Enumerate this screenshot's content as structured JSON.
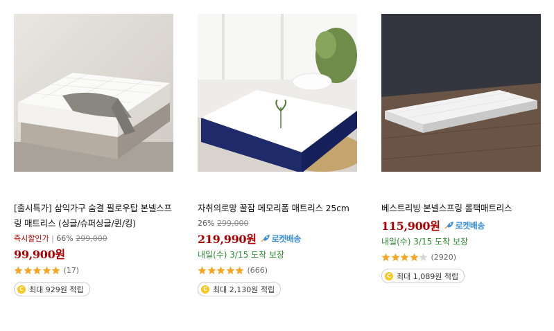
{
  "products": [
    {
      "title": "[출시특가] 삼익가구 숨결 필로우탑 본넬스프링 매트리스 (싱글/슈퍼싱글/퀸/킹)",
      "promo_label": "즉시할인가",
      "discount": "66%",
      "original_price": "299,000",
      "price": "99,900원",
      "rating": 5,
      "review_count": "(17)",
      "cashback": "최대 929원 적립"
    },
    {
      "title": "자취의로망 꿀잠 메모리폼 매트리스 25cm",
      "discount": "26%",
      "original_price": "299,000",
      "price": "219,990원",
      "rocket_label": "로켓배송",
      "delivery": "내일(수) 3/15 도착 보장",
      "rating": 5,
      "review_count": "(666)",
      "cashback": "최대 2,130원 적립"
    },
    {
      "title": "베스트리빙 본넬스프링 롤팩매트리스",
      "price": "115,900원",
      "rocket_label": "로켓배송",
      "delivery": "내일(수) 3/15 도착 보장",
      "rating": 4,
      "review_count": "(2920)",
      "cashback": "최대 1,089원 적립"
    }
  ],
  "colors": {
    "price_red": "#ae0000",
    "rocket_blue": "#3a8fd8",
    "delivery_green": "#2f8a2f",
    "star_orange": "#f5a623",
    "coin_yellow": "#f7c71e"
  },
  "icons": {
    "rocket": "rocket-icon",
    "star": "star-icon",
    "coin": "coin-icon"
  }
}
